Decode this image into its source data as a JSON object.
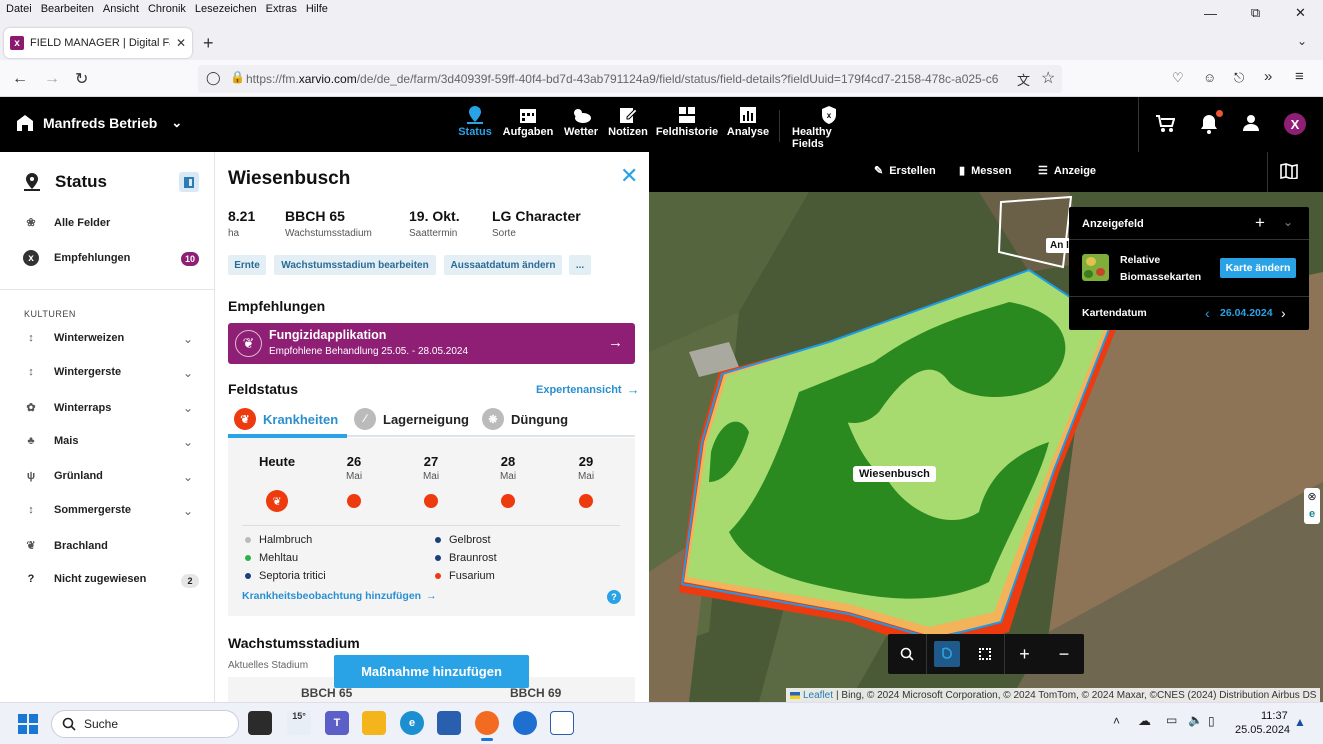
{
  "browser": {
    "menu": [
      "Datei",
      "Bearbeiten",
      "Ansicht",
      "Chronik",
      "Lesezeichen",
      "Extras",
      "Hilfe"
    ],
    "tab_title": "FIELD MANAGER | Digital Farm",
    "url_prefix": "https://fm.",
    "url_domain": "xarvio.com",
    "url_rest": "/de/de_de/farm/3d40939f-59ff-40f4-bd7d-43ab791124a9/field/status/field-details?fieldUuid=179f4cd7-2158-478c-a025-c6"
  },
  "header": {
    "farm_name": "Manfreds Betrieb",
    "nav": [
      {
        "label": "Status",
        "icon": "pin-icon",
        "active": true
      },
      {
        "label": "Aufgaben",
        "icon": "calendar-icon"
      },
      {
        "label": "Wetter",
        "icon": "weather-icon"
      },
      {
        "label": "Notizen",
        "icon": "note-icon"
      },
      {
        "label": "Feldhistorie",
        "icon": "history-icon"
      },
      {
        "label": "Analyse",
        "icon": "chart-icon"
      },
      {
        "label": "Healthy Fields",
        "icon": "shield-icon"
      }
    ],
    "user_initial": "X"
  },
  "sidebar": {
    "title": "Status",
    "all_fields": "Alle Felder",
    "recommendations": "Empfehlungen",
    "recommendations_count": "10",
    "section_label": "KULTUREN",
    "crops": [
      "Winterweizen",
      "Wintergerste",
      "Winterraps",
      "Mais",
      "Grünland",
      "Sommergerste",
      "Brachland",
      "Nicht zugewiesen"
    ],
    "unassigned_count": "2"
  },
  "field": {
    "name": "Wiesenbusch",
    "stats": [
      {
        "value": "8.21",
        "label": "ha"
      },
      {
        "value": "BBCH 65",
        "label": "Wachstumsstadium"
      },
      {
        "value": "19. Okt.",
        "label": "Saattermin"
      },
      {
        "value": "LG Character",
        "label": "Sorte"
      }
    ],
    "chips": [
      "Ernte",
      "Wachstumsstadium bearbeiten",
      "Aussaatdatum ändern",
      "..."
    ],
    "reco_heading": "Empfehlungen",
    "reco_title": "Fungizidapplikation",
    "reco_sub": "Empfohlene Behandlung 25.05. - 28.05.2024",
    "status_heading": "Feldstatus",
    "expert_view": "Expertenansicht",
    "tabs": [
      "Krankheiten",
      "Lagerneigung",
      "Düngung"
    ],
    "days": [
      {
        "d": "Heute",
        "m": ""
      },
      {
        "d": "26",
        "m": "Mai"
      },
      {
        "d": "27",
        "m": "Mai"
      },
      {
        "d": "28",
        "m": "Mai"
      },
      {
        "d": "29",
        "m": "Mai"
      }
    ],
    "diseases": [
      {
        "name": "Halmbruch",
        "color": "#bbbbbb"
      },
      {
        "name": "Gelbrost",
        "color": "#1b3f7a"
      },
      {
        "name": "Mehltau",
        "color": "#2bb24c"
      },
      {
        "name": "Braunrost",
        "color": "#1b3f7a"
      },
      {
        "name": "Septoria tritici",
        "color": "#1b3f7a"
      },
      {
        "name": "Fusarium",
        "color": "#ee3a0f"
      }
    ],
    "add_observation": "Krankheitsbeobachtung hinzufügen",
    "growth_heading": "Wachstumsstadium",
    "growth_sub": "Aktuelles Stadium",
    "bbch_a": "BBCH 65",
    "bbch_b": "BBCH 69",
    "add_measure": "Maßnahme hinzufügen"
  },
  "map": {
    "toolbar": [
      "Erstellen",
      "Messen",
      "Anzeige"
    ],
    "panel_title": "Anzeigefeld",
    "layer_name": "Relative Biomassekarten",
    "change_map": "Karte ändern",
    "map_date_label": "Kartendatum",
    "map_date": "26.04.2024",
    "field_label": "Wiesenbusch",
    "neighbor_label": "An I",
    "attribution_leaflet": "Leaflet",
    "attribution": "| Bing, © 2024 Microsoft Corporation, © 2024 TomTom, © 2024 Maxar, ©CNES (2024) Distribution Airbus DS"
  },
  "taskbar": {
    "search": "Suche",
    "temp": "15°",
    "time": "11:37",
    "date": "25.05.2024"
  }
}
